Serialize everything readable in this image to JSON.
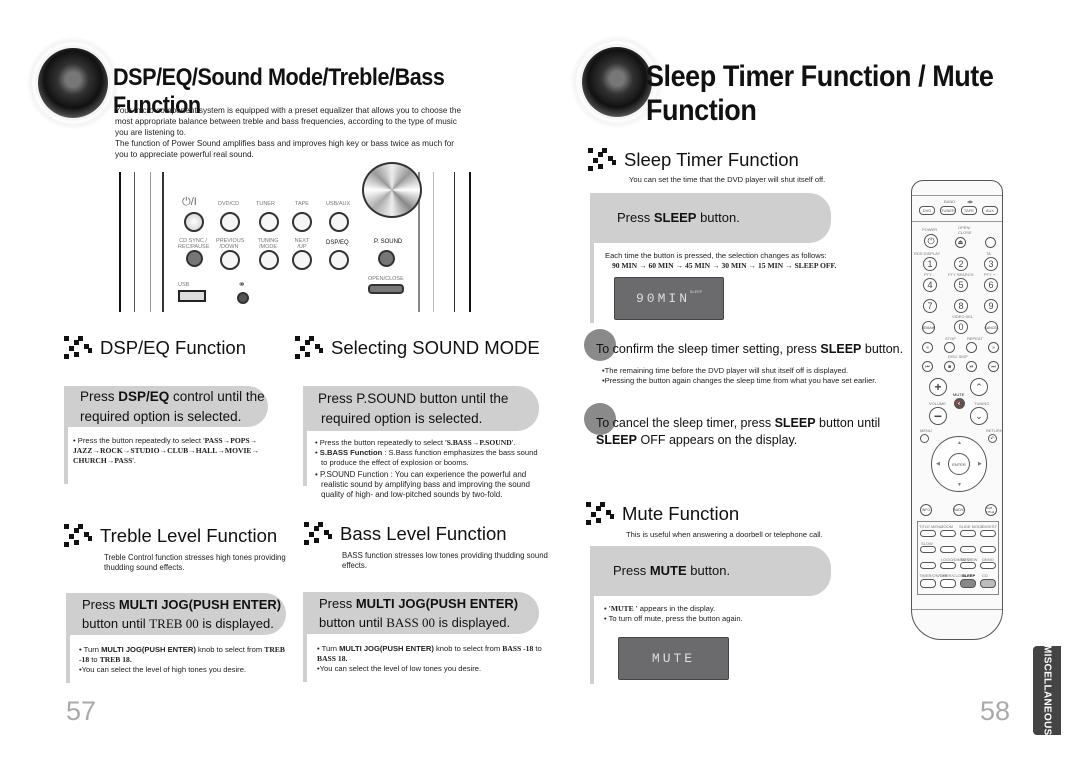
{
  "left_page": {
    "title": "DSP/EQ/Sound Mode/Treble/Bass Function",
    "intro": [
      "Your micro component system is equipped with a preset equalizer that allows you to choose the",
      "most appropriate balance between treble and bass frequencies, according to the type of music",
      "you are listening to.",
      "The function of Power Sound amplifies bass and improves high key or bass twice as much for",
      "you to appreciate powerful real sound."
    ],
    "device_panel": {
      "top_labels": [
        "DVD/CD",
        "TUNER",
        "TAPE",
        "USB/AUX"
      ],
      "power_label": "⏻/I",
      "mid_labels": [
        "CD SYNC / REC/PAUSE",
        "PREVIOUS /DOWN",
        "TUNING /MODE",
        "NEXT /UP",
        "DSP/EQ"
      ],
      "psound_label": "P. SOUND",
      "open_close_label": "OPEN/CLOSE",
      "usb_label": "USB",
      "headphone_icon": "headphones-icon"
    },
    "dsp_eq": {
      "title": "DSP/EQ Function",
      "bubble_pre": "Press ",
      "bubble_bold": "DSP/EQ",
      "bubble_post": "  control until the",
      "bubble_line2": "required option is selected.",
      "note_pre": "Press the button repeatedly to select '",
      "note_seq": "PASS→POPS→ JAZZ→ROCK→STUDIO→CLUB→HALL→MOVIE→ CHURCH→PASS",
      "note_post": "'."
    },
    "sound_mode": {
      "title": "Selecting SOUND MODE",
      "bubble_line1": "Press P.SOUND button until the",
      "bubble_line2": "required option is selected.",
      "note1_pre": "Press the button repeatedly to select '",
      "note1_seq": "S.BASS→P.SOUND",
      "note1_post": "'.",
      "note2_bold": "S.BASS Function",
      "note2_text": " : S.Bass function emphasizes the bass sound to produce the effect of explosion or booms.",
      "note3_text": "P.SOUND Function : You can experience the powerful and realistic sound by amplifying bass and improving the sound quality of high- and low-pitched sounds by two-fold."
    },
    "treble": {
      "title": "Treble Level Function",
      "desc": "Treble Control function stresses high tones providing thudding sound effects.",
      "bubble_pre": "Press ",
      "bubble_bold": "MULTI JOG(PUSH ENTER)",
      "bubble_line2_pre": "button until ",
      "bubble_line2_code": "TREB 00",
      "bubble_line2_post": " is displayed.",
      "note1_pre": "Turn ",
      "note1_bold": "MULTI JOG(PUSH ENTER)",
      "note1_mid": " knob to select from ",
      "note1_range_a": "TREB -18",
      "note1_to": " to ",
      "note1_range_b": "TREB 18.",
      "note2": "You can select the level of high tones you desire."
    },
    "bass": {
      "title": "Bass Level Function",
      "desc": "BASS function stresses low tones providing thudding sound effects.",
      "bubble_pre": "Press ",
      "bubble_bold": "MULTI JOG(PUSH ENTER)",
      "bubble_line2_pre": "button until ",
      "bubble_line2_code": "BASS 00",
      "bubble_line2_post": " is displayed.",
      "note1_pre": "Turn ",
      "note1_bold": "MULTI JOG(PUSH ENTER)",
      "note1_mid": " knob to select from ",
      "note1_range_a": "BASS -18",
      "note1_to": " to ",
      "note1_range_b": "BASS 18.",
      "note2": "You can select the level of low  tones you desire."
    },
    "page_number": "57"
  },
  "right_page": {
    "title": "Sleep Timer Function / Mute Function",
    "sleep": {
      "title": "Sleep Timer Function",
      "desc": "You can set the time that the DVD player will shut itself off.",
      "bubble_pre": "Press ",
      "bubble_bold": "SLEEP",
      "bubble_post": " button.",
      "note_line1": "Each time the button is pressed, the selection changes as follows:",
      "note_line2": "90 MIN → 60 MIN → 45 MIN → 30 MIN → 15 MIN → SLEEP OFF.",
      "lcd_text": "90MIN",
      "lcd_indicator": "SLEEP",
      "step2_pre": "To confirm the sleep timer setting, press ",
      "step2_bold": "SLEEP",
      "step2_post": " button.",
      "step2_notes": [
        "The remaining time before the DVD player will shut itself off is displayed.",
        "Pressing the button again changes the sleep time from what you have set earlier."
      ],
      "step3_pre": "To cancel the sleep timer, press ",
      "step3_bold": "SLEEP",
      "step3_mid": " button until",
      "step3_bold2": "SLEEP",
      "step3_post": " OFF appears on the display."
    },
    "mute": {
      "title": "Mute Function",
      "desc": "This is useful when answering a doorbell or telephone call.",
      "bubble_pre": "Press ",
      "bubble_bold": "MUTE",
      "bubble_post": " button.",
      "note1_code": "'MUTE '",
      "note1_post": " appears in the display.",
      "note2": "To turn off mute, press the button again.",
      "lcd_text": "MUTE"
    },
    "remote": {
      "source_buttons": [
        "DVD",
        "TUNER",
        "TAPE",
        "AUX"
      ],
      "top_labels": [
        "BAND",
        "◀▶"
      ],
      "power_label": "POWER",
      "open_close_label": "OPEN/ CLOSE",
      "numbers": [
        "1",
        "2",
        "3",
        "4",
        "5",
        "6",
        "7",
        "8",
        "9",
        "0"
      ],
      "num_labels": [
        "RDS DISPLAY",
        "TA",
        "PTY -",
        "PTY SEARCH",
        "PTY +",
        "VIDEO SEL"
      ],
      "side_buttons": [
        "REMAIN",
        "CANCEL"
      ],
      "stop_repeat": [
        "STOP",
        "REPEAT"
      ],
      "disc_skip": "DISC SKIP",
      "mute_label": "MUTE",
      "volume_label": "VOLUME",
      "tuning_label": "TUNING",
      "menu_label": "MENU",
      "return_label": "RETURN",
      "enter_label": "ENTER",
      "bottom_round": [
        "INFO",
        "AUDIO",
        "SUB TITLE"
      ],
      "grid_labels": [
        "TITLE MENU",
        "ZOOM",
        "SLIDE MODE",
        "DIGEST",
        "SLOW",
        "LOGO/DIMMER",
        "EZ VIEW",
        "DEMO",
        "TIMER/ON/OFF",
        "TIMER/CLOCK",
        "SLEEP",
        "CD SYNC"
      ],
      "highlighted": "SLEEP"
    },
    "side_tab": "MISCELLANEOUS",
    "page_number": "58"
  }
}
